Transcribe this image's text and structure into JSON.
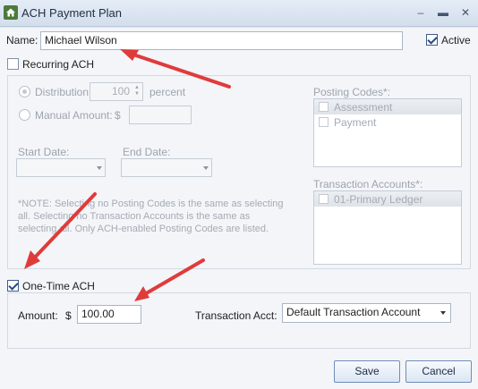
{
  "window": {
    "title": "ACH Payment Plan",
    "controls": {
      "minimize": "–",
      "maximize": "▬",
      "close": "✕"
    }
  },
  "name_field": {
    "label": "Name:",
    "value": "Michael Wilson"
  },
  "active": {
    "label": "Active",
    "checked": true
  },
  "recurring": {
    "label": "Recurring ACH",
    "checked": false,
    "distribution_label": "Distribution:",
    "distribution_value": "100",
    "percent_label": "percent",
    "manual_amount_label": "Manual Amount:",
    "currency_symbol": "$",
    "manual_amount_value": "",
    "start_date_label": "Start Date:",
    "end_date_label": "End Date:",
    "note": "*NOTE:  Selecting no Posting Codes is the same as selecting all.  Selecting no Transaction Accounts is the same as selecting all.  Only ACH-enabled Posting Codes are listed.",
    "posting_codes_label": "Posting Codes*:",
    "posting_codes": [
      "Assessment",
      "Payment"
    ],
    "transaction_accounts_label": "Transaction Accounts*:",
    "transaction_accounts": [
      "01-Primary Ledger"
    ]
  },
  "one_time": {
    "label": "One-Time ACH",
    "checked": true,
    "amount_label": "Amount:",
    "currency_symbol": "$",
    "amount_value": "100.00",
    "transaction_acct_label": "Transaction Acct:",
    "transaction_acct_value": "Default Transaction Account"
  },
  "buttons": {
    "save": "Save",
    "cancel": "Cancel"
  },
  "colors": {
    "annotation_arrow": "#e03b3b",
    "accent": "#3f5c8a"
  }
}
